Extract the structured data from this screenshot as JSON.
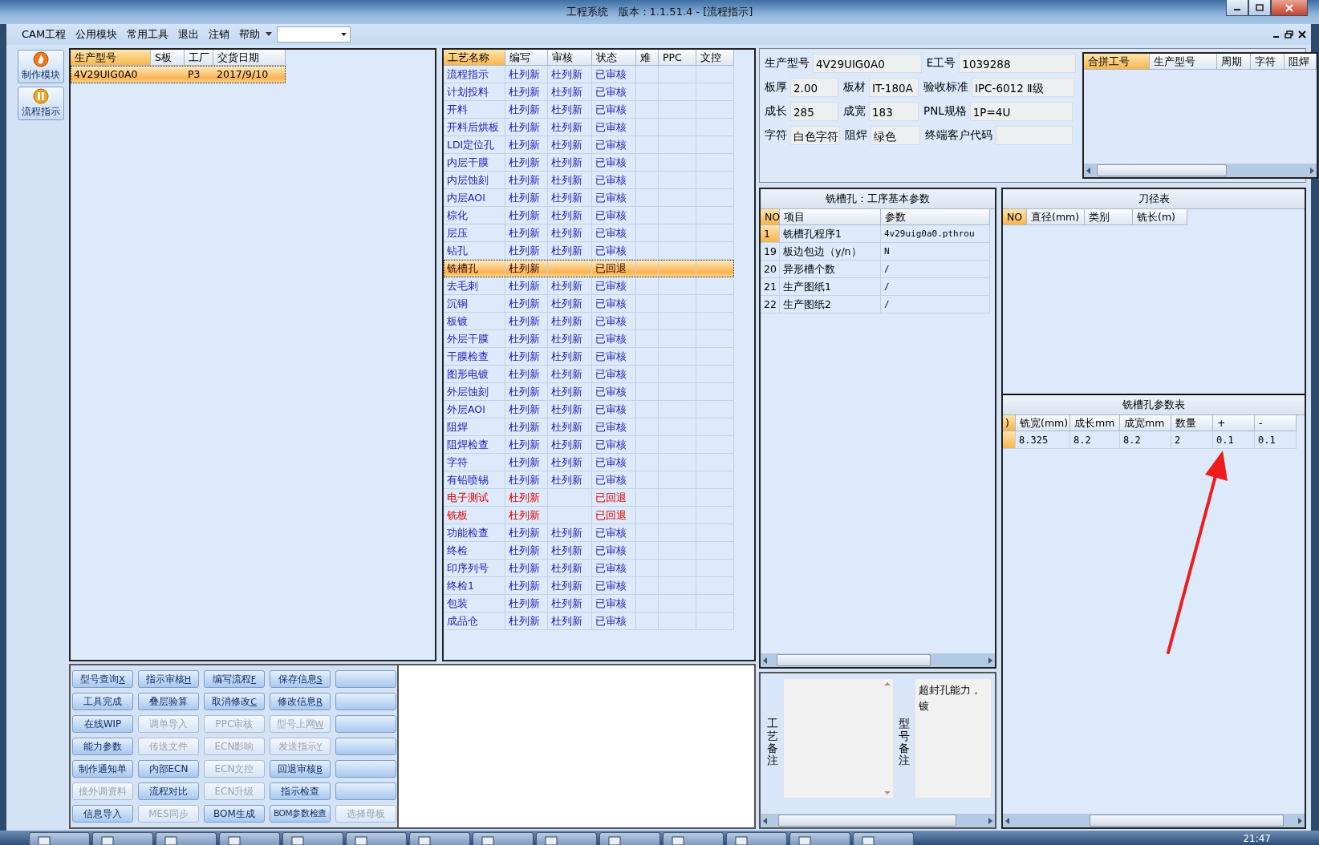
{
  "window": {
    "title": "工程系统　版本：1.1.51.4 - [流程指示]"
  },
  "menu": {
    "items": [
      "CAM工程",
      "公用模块",
      "常用工具",
      "退出",
      "注销",
      "帮助"
    ]
  },
  "toolbar": [
    {
      "label": "制作模块",
      "kind": "flame"
    },
    {
      "label": "流程指示",
      "kind": "pause"
    }
  ],
  "orders": {
    "columns": [
      "生产型号",
      "S板",
      "工厂",
      "交货日期"
    ],
    "rows": [
      {
        "cells": [
          "4V29UIG0A0",
          "",
          "P3",
          "2017/9/10"
        ],
        "selected": true
      }
    ]
  },
  "process": {
    "columns": [
      "工艺名称",
      "编写",
      "审核",
      "状态",
      "难",
      "PPC",
      "文控"
    ],
    "rows": [
      {
        "name": "流程指示",
        "writer": "杜列新",
        "reviewer": "杜列新",
        "status": "已审核",
        "flagged": false,
        "selected": false
      },
      {
        "name": "计划投料",
        "writer": "杜列新",
        "reviewer": "杜列新",
        "status": "已审核",
        "flagged": false,
        "selected": false
      },
      {
        "name": "开料",
        "writer": "杜列新",
        "reviewer": "杜列新",
        "status": "已审核",
        "flagged": false,
        "selected": false
      },
      {
        "name": "开料后烘板",
        "writer": "杜列新",
        "reviewer": "杜列新",
        "status": "已审核",
        "flagged": false,
        "selected": false
      },
      {
        "name": "LDI定位孔",
        "writer": "杜列新",
        "reviewer": "杜列新",
        "status": "已审核",
        "flagged": false,
        "selected": false
      },
      {
        "name": "内层干膜",
        "writer": "杜列新",
        "reviewer": "杜列新",
        "status": "已审核",
        "flagged": false,
        "selected": false
      },
      {
        "name": "内层蚀刻",
        "writer": "杜列新",
        "reviewer": "杜列新",
        "status": "已审核",
        "flagged": false,
        "selected": false
      },
      {
        "name": "内层AOI",
        "writer": "杜列新",
        "reviewer": "杜列新",
        "status": "已审核",
        "flagged": false,
        "selected": false
      },
      {
        "name": "棕化",
        "writer": "杜列新",
        "reviewer": "杜列新",
        "status": "已审核",
        "flagged": false,
        "selected": false
      },
      {
        "name": "层压",
        "writer": "杜列新",
        "reviewer": "杜列新",
        "status": "已审核",
        "flagged": false,
        "selected": false
      },
      {
        "name": "钻孔",
        "writer": "杜列新",
        "reviewer": "杜列新",
        "status": "已审核",
        "flagged": false,
        "selected": false
      },
      {
        "name": "铣槽孔",
        "writer": "杜列新",
        "status": "已回退",
        "flagged": true,
        "selected": true
      },
      {
        "name": "去毛刺",
        "writer": "杜列新",
        "reviewer": "杜列新",
        "status": "已审核",
        "flagged": false,
        "selected": false
      },
      {
        "name": "沉铜",
        "writer": "杜列新",
        "reviewer": "杜列新",
        "status": "已审核",
        "flagged": false,
        "selected": false
      },
      {
        "name": "板镀",
        "writer": "杜列新",
        "reviewer": "杜列新",
        "status": "已审核",
        "flagged": false,
        "selected": false
      },
      {
        "name": "外层干膜",
        "writer": "杜列新",
        "reviewer": "杜列新",
        "status": "已审核",
        "flagged": false,
        "selected": false
      },
      {
        "name": "干膜检查",
        "writer": "杜列新",
        "reviewer": "杜列新",
        "status": "已审核",
        "flagged": false,
        "selected": false
      },
      {
        "name": "图形电镀",
        "writer": "杜列新",
        "reviewer": "杜列新",
        "status": "已审核",
        "flagged": false,
        "selected": false
      },
      {
        "name": "外层蚀刻",
        "writer": "杜列新",
        "reviewer": "杜列新",
        "status": "已审核",
        "flagged": false,
        "selected": false
      },
      {
        "name": "外层AOI",
        "writer": "杜列新",
        "reviewer": "杜列新",
        "status": "已审核",
        "flagged": false,
        "selected": false
      },
      {
        "name": "阻焊",
        "writer": "杜列新",
        "reviewer": "杜列新",
        "status": "已审核",
        "flagged": false,
        "selected": false
      },
      {
        "name": "阻焊检查",
        "writer": "杜列新",
        "reviewer": "杜列新",
        "status": "已审核",
        "flagged": false,
        "selected": false
      },
      {
        "name": "字符",
        "writer": "杜列新",
        "reviewer": "杜列新",
        "status": "已审核",
        "flagged": false,
        "selected": false
      },
      {
        "name": "有铅喷锡",
        "writer": "杜列新",
        "reviewer": "杜列新",
        "status": "已审核",
        "flagged": false,
        "selected": false
      },
      {
        "name": "电子测试",
        "writer": "杜列新",
        "status": "已回退",
        "flagged": true,
        "selected": false
      },
      {
        "name": "铣板",
        "writer": "杜列新",
        "status": "已回退",
        "flagged": true,
        "selected": false
      },
      {
        "name": "功能检查",
        "writer": "杜列新",
        "reviewer": "杜列新",
        "status": "已审核",
        "flagged": false,
        "selected": false
      },
      {
        "name": "终检",
        "writer": "杜列新",
        "reviewer": "杜列新",
        "status": "已审核",
        "flagged": false,
        "selected": false
      },
      {
        "name": "印序列号",
        "writer": "杜列新",
        "reviewer": "杜列新",
        "status": "已审核",
        "flagged": false,
        "selected": false
      },
      {
        "name": "终检1",
        "writer": "杜列新",
        "reviewer": "杜列新",
        "status": "已审核",
        "flagged": false,
        "selected": false
      },
      {
        "name": "包装",
        "writer": "杜列新",
        "reviewer": "杜列新",
        "status": "已审核",
        "flagged": false,
        "selected": false
      },
      {
        "name": "成品仓",
        "writer": "杜列新",
        "reviewer": "杜列新",
        "status": "已审核",
        "flagged": false,
        "selected": false
      }
    ]
  },
  "buttons": [
    {
      "kind": "text",
      "label": "型号查询",
      "hotkey": "X",
      "disabled": false
    },
    {
      "kind": "text",
      "label": "指示审核",
      "hotkey": "H",
      "disabled": false
    },
    {
      "kind": "text",
      "label": "编写流程",
      "hotkey": "F",
      "disabled": false
    },
    {
      "kind": "text",
      "label": "保存信息",
      "hotkey": "S",
      "disabled": false
    },
    {
      "kind": "blank",
      "disabled": false
    },
    {
      "kind": "text",
      "label": "工具完成",
      "disabled": false
    },
    {
      "kind": "text",
      "label": "叠层验算",
      "disabled": false
    },
    {
      "kind": "text",
      "label": "取消修改",
      "hotkey": "C",
      "disabled": false
    },
    {
      "kind": "text",
      "label": "修改信息",
      "hotkey": "R",
      "disabled": false
    },
    {
      "kind": "blank",
      "disabled": false
    },
    {
      "kind": "text",
      "label": "在线WIP",
      "disabled": false
    },
    {
      "kind": "text",
      "label": "调单导入",
      "disabled": true
    },
    {
      "kind": "text",
      "label": "PPC审核",
      "disabled": true
    },
    {
      "kind": "text",
      "label": "型号上网",
      "hotkey": "W",
      "disabled": true
    },
    {
      "kind": "blank",
      "disabled": false
    },
    {
      "kind": "text",
      "label": "能力参数",
      "disabled": false
    },
    {
      "kind": "text",
      "label": "传送文件",
      "disabled": true
    },
    {
      "kind": "text",
      "label": "ECN影响",
      "disabled": true
    },
    {
      "kind": "text",
      "label": "发送指示",
      "hotkey": "Y",
      "disabled": true
    },
    {
      "kind": "blank",
      "disabled": false
    },
    {
      "kind": "text",
      "label": "制作通知单",
      "disabled": false
    },
    {
      "kind": "text",
      "label": "内部ECN",
      "disabled": false
    },
    {
      "kind": "text",
      "label": "ECN文控",
      "disabled": true
    },
    {
      "kind": "text",
      "label": "回退审核",
      "hotkey": "B",
      "disabled": false
    },
    {
      "kind": "blank",
      "disabled": false
    },
    {
      "kind": "text",
      "label": "接外调资料",
      "disabled": true
    },
    {
      "kind": "text",
      "label": "流程对比",
      "disabled": false
    },
    {
      "kind": "text",
      "label": "ECN升级",
      "disabled": true
    },
    {
      "kind": "text",
      "label": "指示检查",
      "disabled": false
    },
    {
      "kind": "blank",
      "disabled": false
    },
    {
      "kind": "text",
      "label": "信息导入",
      "disabled": false
    },
    {
      "kind": "text",
      "label": "MES同步",
      "disabled": true
    },
    {
      "kind": "text",
      "label": "BOM生成",
      "disabled": false
    },
    {
      "kind": "text",
      "label": "BOM参数检查",
      "disabled": false
    },
    {
      "kind": "text",
      "label": "选择母板",
      "disabled": true
    }
  ],
  "info": {
    "fields": [
      {
        "label": "生产型号",
        "value": "4V29UIG0A0"
      },
      {
        "label": "E工号",
        "value": "1039288"
      },
      {
        "label": "板厚",
        "value": "2.00"
      },
      {
        "label": "板材",
        "value": "IT-180A"
      },
      {
        "label": "验收标准",
        "value": "IPC-6012 Ⅱ级"
      },
      {
        "label": "成长",
        "value": "285"
      },
      {
        "label": "成宽",
        "value": "183"
      },
      {
        "label": "PNL规格",
        "value": "1P=4U"
      },
      {
        "label": "字符",
        "value": "白色字符"
      },
      {
        "label": "阻焊",
        "value": "绿色"
      },
      {
        "label": "终端客户代码"
      }
    ]
  },
  "merge_table": {
    "columns": [
      "合拼工号",
      "生产型号",
      "周期",
      "字符",
      "阻焊"
    ]
  },
  "params": {
    "title": "铣槽孔：工序基本参数",
    "columns": [
      "NO",
      "项目",
      "参数"
    ],
    "rows": [
      {
        "no": "1",
        "item": "铣槽孔程序1",
        "value": "4v29uig0a0.pthrou",
        "selected": true
      },
      {
        "no": "19",
        "item": "板边包边（y/n）",
        "value": "N",
        "selected": false
      },
      {
        "no": "20",
        "item": "异形槽个数",
        "value": "/",
        "selected": false
      },
      {
        "no": "21",
        "item": "生产图纸1",
        "value": "/",
        "selected": false
      },
      {
        "no": "22",
        "item": "生产图纸2",
        "value": "/",
        "selected": false
      }
    ]
  },
  "tool_table": {
    "title": "刀径表",
    "columns": [
      "NO",
      "直径(mm)",
      "类别",
      "铣长(m)"
    ]
  },
  "slot_table": {
    "title": "铣槽孔参数表",
    "marker_header": ")",
    "columns": [
      "铣宽(mm)",
      "成长mm",
      "成宽mm",
      "数量",
      "+",
      "-"
    ],
    "rows": [
      {
        "cells": [
          "8.325",
          "8.2",
          "8.2",
          "2",
          "0.1",
          "0.1"
        ],
        "selected": true
      }
    ]
  },
  "remarks": {
    "process_label": "工艺备注",
    "model_label": "型号备注",
    "model_lines": [
      "超封孔能力，",
      "镀"
    ]
  },
  "taskbar": {
    "clock": "21:47"
  }
}
